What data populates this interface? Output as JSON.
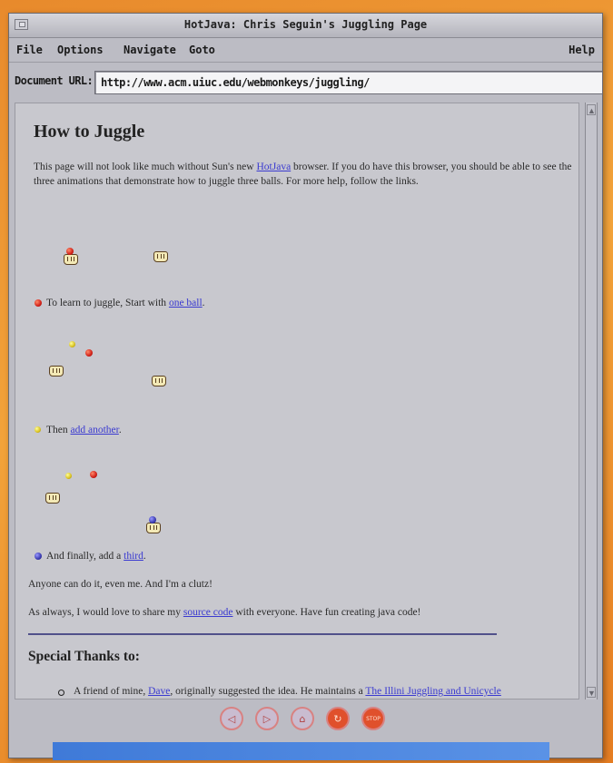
{
  "window": {
    "title": "HotJava: Chris Seguin's Juggling Page"
  },
  "menu": {
    "file": "File",
    "options": "Options",
    "navigate": "Navigate",
    "goto": "Goto",
    "help": "Help"
  },
  "url": {
    "label": "Document URL:",
    "value": "http://www.acm.uiuc.edu/webmonkeys/juggling/"
  },
  "page": {
    "title": "How to Juggle",
    "intro": {
      "before": "This page will not look like much without Sun's new ",
      "link": "HotJava",
      "after": " browser. If you do have this browser, you should be able to see the three animations that demonstrate how to juggle three balls. For more help, follow the links."
    },
    "step1": {
      "before": "To learn to juggle, Start with ",
      "link": "one ball",
      "after": "."
    },
    "step2": {
      "before": "Then ",
      "link": "add another",
      "after": "."
    },
    "step3": {
      "before": "And finally, add a ",
      "link": "third",
      "after": "."
    },
    "clutz": "Anyone can do it, even me. And I'm a clutz!",
    "source": {
      "before": "As always, I would love to share my ",
      "link": "source code",
      "after": " with everyone. Have fun creating java code!"
    },
    "thanks_heading": "Special Thanks to:",
    "thanks_item": {
      "before": "A friend of mine, ",
      "link1": "Dave",
      "middle": ", originally suggested the idea. He maintains a ",
      "link2": "The Illini Juggling and Unicycle"
    }
  },
  "toolbar": {
    "back": "◁",
    "forward": "▷",
    "home": "⌂",
    "reload": "↻",
    "stop": "STOP"
  },
  "colors": {
    "ball_red": "#d02018",
    "ball_yellow": "#d8c020",
    "ball_blue": "#3a3ab0",
    "link": "#3a3ad0"
  },
  "icons": [
    "window-menu-icon",
    "hand-icon",
    "ball-icon",
    "back-icon",
    "forward-icon",
    "home-icon",
    "reload-icon",
    "stop-icon"
  ]
}
